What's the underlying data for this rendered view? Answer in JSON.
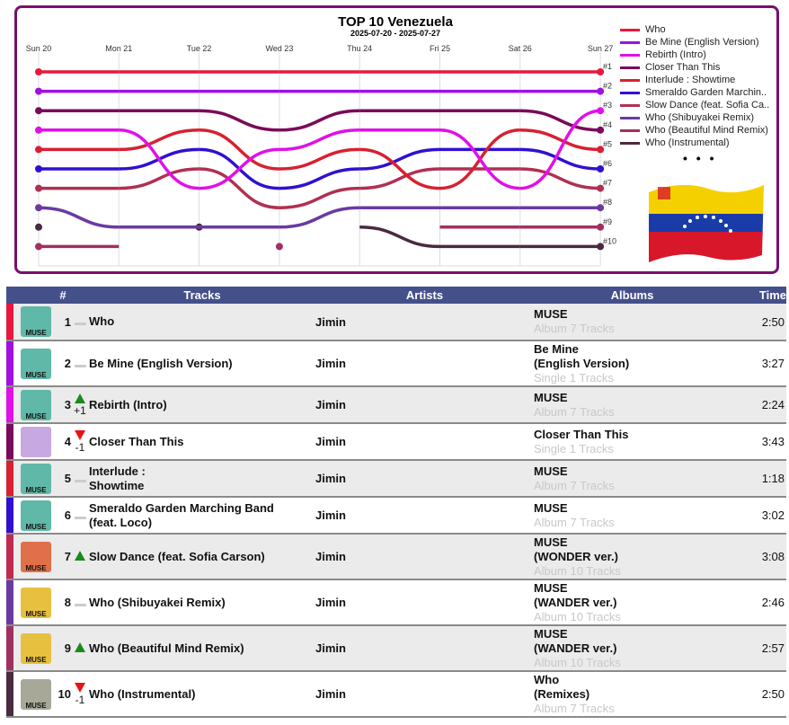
{
  "chart_data": {
    "type": "line",
    "title": "TOP 10 Venezuela",
    "subtitle": "2025-07-20 - 2025-07-27",
    "x": [
      "Sun 20",
      "Mon 21",
      "Tue 22",
      "Wed 23",
      "Thu 24",
      "Fri 25",
      "Sat 26",
      "Sun 27"
    ],
    "y_tick_labels": [
      "#1",
      "#2",
      "#3",
      "#4",
      "#5",
      "#6",
      "#7",
      "#8",
      "#9",
      "#10"
    ],
    "ylim": [
      1,
      10
    ],
    "y_inverted": true,
    "grid": "vertical",
    "legend_placement": "right",
    "series": [
      {
        "name": "Who",
        "color": "#e8173e",
        "values": [
          1,
          1,
          1,
          1,
          1,
          1,
          1,
          1
        ]
      },
      {
        "name": "Be Mine (English Version)",
        "color": "#a010e0",
        "values": [
          2,
          2,
          2,
          2,
          2,
          2,
          2,
          2
        ]
      },
      {
        "name": "Rebirth (Intro)",
        "color": "#e010e8",
        "values": [
          4,
          4,
          7,
          5,
          4,
          4,
          7,
          3
        ]
      },
      {
        "name": "Closer Than This",
        "color": "#7a0a5a",
        "values": [
          3,
          3,
          3,
          4,
          3,
          3,
          3,
          4
        ]
      },
      {
        "name": "Interlude : Showtime",
        "color": "#d82030",
        "values": [
          5,
          5,
          4,
          6,
          5,
          7,
          4,
          5
        ]
      },
      {
        "name": "Smeraldo Garden Marchin..",
        "color": "#3010d0",
        "values": [
          6,
          6,
          5,
          7,
          6,
          5,
          5,
          6
        ]
      },
      {
        "name": "Slow Dance (feat. Sofia Ca..",
        "color": "#b03050",
        "values": [
          7,
          7,
          6,
          8,
          7,
          6,
          6,
          7
        ]
      },
      {
        "name": "Who (Shibuyakei Remix)",
        "color": "#6a3aa0",
        "values": [
          8,
          9,
          9,
          9,
          8,
          8,
          8,
          8
        ]
      },
      {
        "name": "Who (Beautiful Mind Remix)",
        "color": "#a03060",
        "values": [
          10,
          10,
          null,
          10,
          null,
          9,
          9,
          9
        ]
      },
      {
        "name": "Who (Instrumental)",
        "color": "#4a2a40",
        "values": [
          9,
          null,
          9,
          null,
          9,
          10,
          10,
          10
        ]
      }
    ],
    "legend_more": "• • •"
  },
  "table": {
    "headers": {
      "rank": "#",
      "tracks": "Tracks",
      "artists": "Artists",
      "albums": "Albums",
      "time": "Time"
    },
    "rows": [
      {
        "rank": "1",
        "change": "flat",
        "change_text": "",
        "track": "Who",
        "artist": "Jimin",
        "album": "MUSE",
        "album_sub": "Album 7 Tracks",
        "time": "2:50",
        "color": "#e8173e",
        "art": "#5fb8a8",
        "art_text": "MUSE"
      },
      {
        "rank": "2",
        "change": "flat",
        "change_text": "",
        "track": "Be Mine (English Version)",
        "artist": "Jimin",
        "album": "Be Mine\n(English Version)",
        "album_sub": "Single 1 Tracks",
        "time": "3:27",
        "color": "#a010e0",
        "art": "#5fb8a8",
        "art_text": "MUSE"
      },
      {
        "rank": "3",
        "change": "up",
        "change_text": "+1",
        "track": "Rebirth (Intro)",
        "artist": "Jimin",
        "album": "MUSE",
        "album_sub": "Album 7 Tracks",
        "time": "2:24",
        "color": "#e010e8",
        "art": "#5fb8a8",
        "art_text": "MUSE"
      },
      {
        "rank": "4",
        "change": "down",
        "change_text": "-1",
        "track": "Closer Than This",
        "artist": "Jimin",
        "album": "Closer Than This",
        "album_sub": "Single 1 Tracks",
        "time": "3:43",
        "color": "#7a0a5a",
        "art": "#c8a8e0",
        "art_text": ""
      },
      {
        "rank": "5",
        "change": "flat",
        "change_text": "",
        "track": "Interlude :\nShowtime",
        "artist": "Jimin",
        "album": "MUSE",
        "album_sub": "Album 7 Tracks",
        "time": "1:18",
        "color": "#d82030",
        "art": "#5fb8a8",
        "art_text": "MUSE"
      },
      {
        "rank": "6",
        "change": "flat",
        "change_text": "",
        "track": "Smeraldo Garden Marching Band\n(feat. Loco)",
        "artist": "Jimin",
        "album": "MUSE",
        "album_sub": "Album 7 Tracks",
        "time": "3:02",
        "color": "#3010d0",
        "art": "#5fb8a8",
        "art_text": "MUSE"
      },
      {
        "rank": "7",
        "change": "up",
        "change_text": "",
        "track": "Slow Dance (feat. Sofia Carson)",
        "artist": "Jimin",
        "album": "MUSE\n(WONDER ver.)",
        "album_sub": "Album 10 Tracks",
        "time": "3:08",
        "color": "#c02850",
        "art": "#e0704a",
        "art_text": "MUSE"
      },
      {
        "rank": "8",
        "change": "flat",
        "change_text": "",
        "track": "Who (Shibuyakei Remix)",
        "artist": "Jimin",
        "album": "MUSE\n(WANDER ver.)",
        "album_sub": "Album 10 Tracks",
        "time": "2:46",
        "color": "#6a3aa0",
        "art": "#e8c040",
        "art_text": "MUSE"
      },
      {
        "rank": "9",
        "change": "up",
        "change_text": "",
        "track": "Who (Beautiful Mind Remix)",
        "artist": "Jimin",
        "album": "MUSE\n(WANDER ver.)",
        "album_sub": "Album 10 Tracks",
        "time": "2:57",
        "color": "#a03060",
        "art": "#e8c040",
        "art_text": "MUSE"
      },
      {
        "rank": "10",
        "change": "down",
        "change_text": "-1",
        "track": "Who (Instrumental)",
        "artist": "Jimin",
        "album": "Who\n(Remixes)",
        "album_sub": "Album 7 Tracks",
        "time": "2:50",
        "color": "#4a2a40",
        "art": "#a8a898",
        "art_text": "MUSE"
      }
    ]
  }
}
